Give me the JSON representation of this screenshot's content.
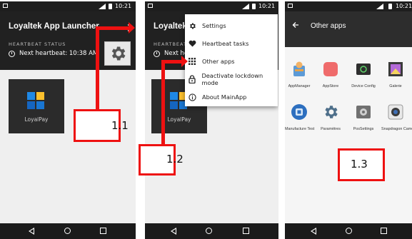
{
  "status": {
    "time": "10:21"
  },
  "screen1": {
    "app_title": "Loyaltek App Launcher",
    "heartbeat_status_label": "HEARTBEAT STATUS",
    "next_heartbeat": "Next heartbeat: 10:38 AM",
    "tile_label": "LoyalPay",
    "step": "1.1"
  },
  "screen2": {
    "app_title": "Loyaltek A",
    "heartbeat_status_label": "HEARTBEAT",
    "next_heartbeat": "Next he",
    "tile_label": "LoyalPay",
    "menu": [
      {
        "label": "Settings",
        "icon": "gear-icon"
      },
      {
        "label": "Heartbeat tasks",
        "icon": "heart-icon"
      },
      {
        "label": "Other apps",
        "icon": "grid-icon"
      },
      {
        "label": "Deactivate lockdown mode",
        "icon": "lock-icon"
      },
      {
        "label": "About MainApp",
        "icon": "info-icon"
      }
    ],
    "step": "1.2"
  },
  "screen3": {
    "title": "Other apps",
    "apps_row1": [
      "AppManager",
      "AppStore",
      "Device Config",
      "Galerie"
    ],
    "apps_row2": [
      "Manufacture Test",
      "Paramètres",
      "PosSettings",
      "Snapdragon Camera"
    ],
    "step": "1.3"
  },
  "colors": {
    "annotation": "#ee1111",
    "appbar": "#212121",
    "statusbar": "#1e1e1e"
  }
}
